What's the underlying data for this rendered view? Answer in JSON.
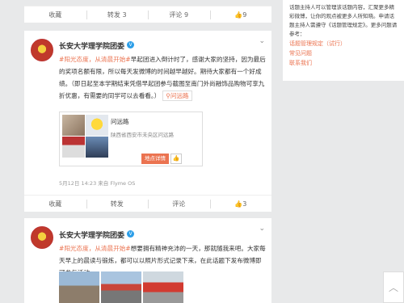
{
  "top_actions": {
    "fav": "收藏",
    "repost": "转发 3",
    "comment": "评论 9",
    "like": "9"
  },
  "post1": {
    "name": "长安大学理学院团委",
    "tag": "#阳光态度，从清晨开始#",
    "text": "早起团进入倒计时了，感谢大家的坚持，因为最后的奖项名额有限，所以每天发微博的时间越早越好。期待大家都有一个好成绩。（即日起至本学期结束凭借早起团参与截图至南门外尚融饰品购物可享九折优惠，有需要的同学可以去看看。）",
    "location_label": "问远路",
    "loc_title": "问远路",
    "loc_address": "陕西省西安市未央区问远路",
    "loc_button": "地点详情",
    "meta": "5月12日 14:23 来自 Flyme OS",
    "actions": {
      "fav": "收藏",
      "repost": "转发",
      "comment": "评论",
      "like": "3"
    }
  },
  "post2": {
    "name": "长安大学理学院团委",
    "tag": "#阳光态度，从清晨开始#",
    "text": "想要拥有精神充沛的一天，那就随我来吧。大家每天早上的晨读与锻炼，都可以以照片形式记录下来，在此话题下发布微博即可参与活动。"
  },
  "sidebar": {
    "text": "话题主持人可以管理该话题内容，汇聚更多精彩微博，让你的观点被更多人所知晓。申请话题主持人需遵守《话题管理规定》。更多问题请参考：",
    "links": [
      "话题管理规定（试行）",
      "常见问题",
      "联系我们"
    ]
  },
  "colors": {
    "accent": "#eb7350",
    "verified": "#2b9ee8",
    "background": "#e8e9ea"
  }
}
